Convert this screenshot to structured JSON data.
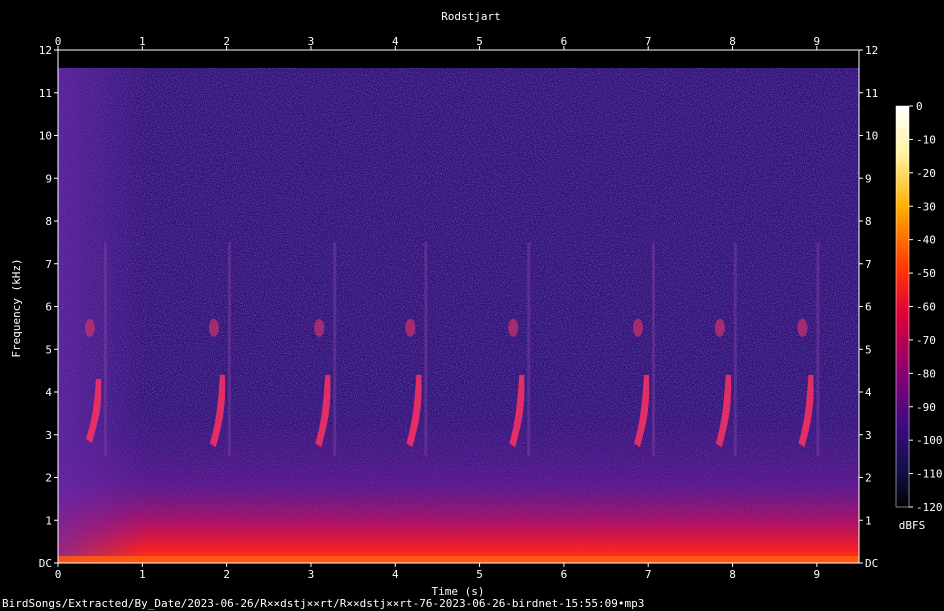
{
  "chart_data": {
    "type": "heatmap",
    "title": "Rodstjart",
    "xlabel": "Time (s)",
    "ylabel": "Frequency (kHz)",
    "xlim": [
      0,
      9.5
    ],
    "ylim": [
      0,
      12
    ],
    "x_ticks": [
      "0",
      "1",
      "2",
      "3",
      "4",
      "5",
      "6",
      "7",
      "8",
      "9"
    ],
    "y_ticks": [
      "DC",
      "1",
      "2",
      "3",
      "4",
      "5",
      "6",
      "7",
      "8",
      "9",
      "10",
      "11",
      "12"
    ],
    "colorbar": {
      "label": "dBFS",
      "range": [
        -120,
        0
      ],
      "ticks": [
        "0",
        "-10",
        "-20",
        "-30",
        "-40",
        "-50",
        "-60",
        "-70",
        "-80",
        "-90",
        "-100",
        "-110",
        "-120"
      ]
    },
    "calls": [
      {
        "t": 0.45,
        "f_low": 2.9,
        "f_high": 4.3
      },
      {
        "t": 1.92,
        "f_low": 2.8,
        "f_high": 4.4
      },
      {
        "t": 3.17,
        "f_low": 2.8,
        "f_high": 4.4
      },
      {
        "t": 4.25,
        "f_low": 2.8,
        "f_high": 4.4
      },
      {
        "t": 5.47,
        "f_low": 2.8,
        "f_high": 4.4
      },
      {
        "t": 6.95,
        "f_low": 2.8,
        "f_high": 4.4
      },
      {
        "t": 7.92,
        "f_low": 2.8,
        "f_high": 4.4
      },
      {
        "t": 8.9,
        "f_low": 2.8,
        "f_high": 4.4
      }
    ]
  },
  "footer": {
    "path": "BirdSongs/Extracted/By_Date/2023-06-26/R××dstj××rt/R××dstj××rt-76-2023-06-26-birdnet-15:55:09•mp3"
  },
  "colors": {
    "background": "#000000",
    "noise_floor": "#2a0f6b",
    "low_freq_band": "#ff2a10",
    "call": "#ff3060"
  }
}
